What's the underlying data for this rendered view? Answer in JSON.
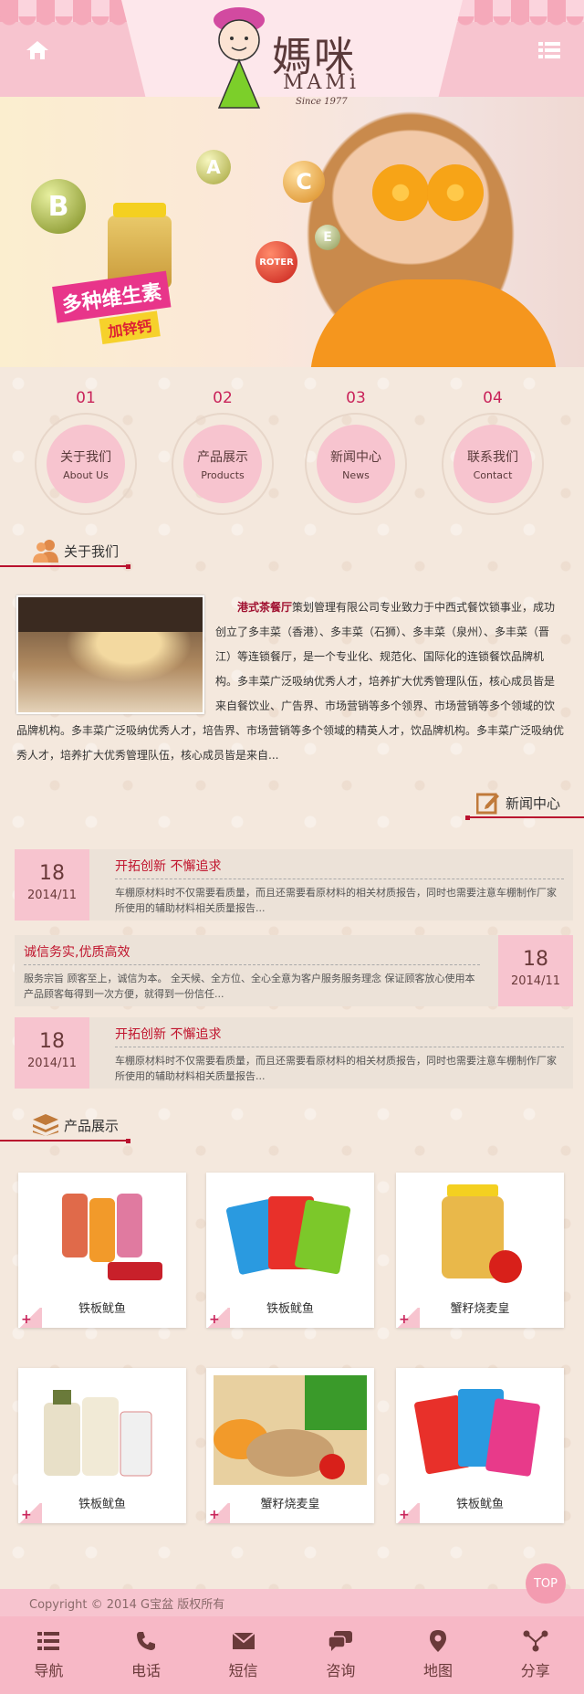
{
  "header": {
    "logo_cn": "媽咪",
    "logo_en": "MAMi",
    "logo_since": "Since 1977"
  },
  "banner": {
    "vitamin_b": "B",
    "vitamin_a": "A",
    "vitamin_c": "C",
    "vitamin_e": "E",
    "roter_label": "ROTER",
    "promo_main": "多种维生素",
    "promo_sub": "加锌钙"
  },
  "nav_circles": [
    {
      "num": "01",
      "cn": "关于我们",
      "en": "About Us"
    },
    {
      "num": "02",
      "cn": "产品展示",
      "en": "Products"
    },
    {
      "num": "03",
      "cn": "新闻中心",
      "en": "News"
    },
    {
      "num": "04",
      "cn": "联系我们",
      "en": "Contact"
    }
  ],
  "about": {
    "title": "关于我们",
    "brand": "港式茶餐厅",
    "text": "策划管理有限公司专业致力于中西式餐饮锁事业，成功创立了多丰菜（香港）、多丰菜（石狮）、多丰菜（泉州）、多丰菜（晋江）等连锁餐厅，是一个专业化、规范化、国际化的连锁餐饮品牌机构。多丰菜广泛吸纳优秀人才，培养扩大优秀管理队伍，核心成员皆是来自餐饮业、广告界、市场营销等多个领界、市场营销等多个领域的饮品牌机构。多丰菜广泛吸纳优秀人才，培告界、市场营销等多个领域的精英人才，饮品牌机构。多丰菜广泛吸纳优秀人才，培养扩大优秀管理队伍，核心成员皆是来自..."
  },
  "news": {
    "title": "新闻中心",
    "items": [
      {
        "day": "18",
        "month": "2014/11",
        "title": "开拓创新  不懈追求",
        "desc": "车棚原材料时不仅需要看质量，而且还需要看原材料的相关材质报告，同时也需要注意车棚制作厂家所使用的辅助材料相关质量报告..."
      },
      {
        "day": "18",
        "month": "2014/11",
        "title": "诚信务实,优质高效",
        "desc": "服务宗旨  顾客至上，诚信为本。  全天候、全方位、全心全意为客户服务服务理念   保证顾客放心使用本产品顾客每得到一次方便，就得到一份信任..."
      },
      {
        "day": "18",
        "month": "2014/11",
        "title": "开拓创新  不懈追求",
        "desc": "车棚原材料时不仅需要看质量，而且还需要看原材料的相关材质报告，同时也需要注意车棚制作厂家所使用的辅助材料相关质量报告..."
      }
    ]
  },
  "products": {
    "title": "产品展示",
    "items": [
      {
        "name": "铁板鱿鱼"
      },
      {
        "name": "铁板鱿鱼"
      },
      {
        "name": "蟹籽烧麦皇"
      },
      {
        "name": "铁板鱿鱼"
      },
      {
        "name": "蟹籽烧麦皇"
      },
      {
        "name": "铁板鱿鱼"
      }
    ]
  },
  "footer": {
    "copyright": "Copyright © 2014 G宝盆 版权所有",
    "top": "TOP"
  },
  "bottom_nav": [
    {
      "label": "导航",
      "icon": "list-icon"
    },
    {
      "label": "电话",
      "icon": "phone-icon"
    },
    {
      "label": "短信",
      "icon": "mail-icon"
    },
    {
      "label": "咨询",
      "icon": "chat-icon"
    },
    {
      "label": "地图",
      "icon": "map-pin-icon"
    },
    {
      "label": "分享",
      "icon": "share-icon"
    }
  ],
  "colors": {
    "pink": "#f7c4cf",
    "accent_red": "#c0142d",
    "text_brown": "#6a3a3a"
  }
}
